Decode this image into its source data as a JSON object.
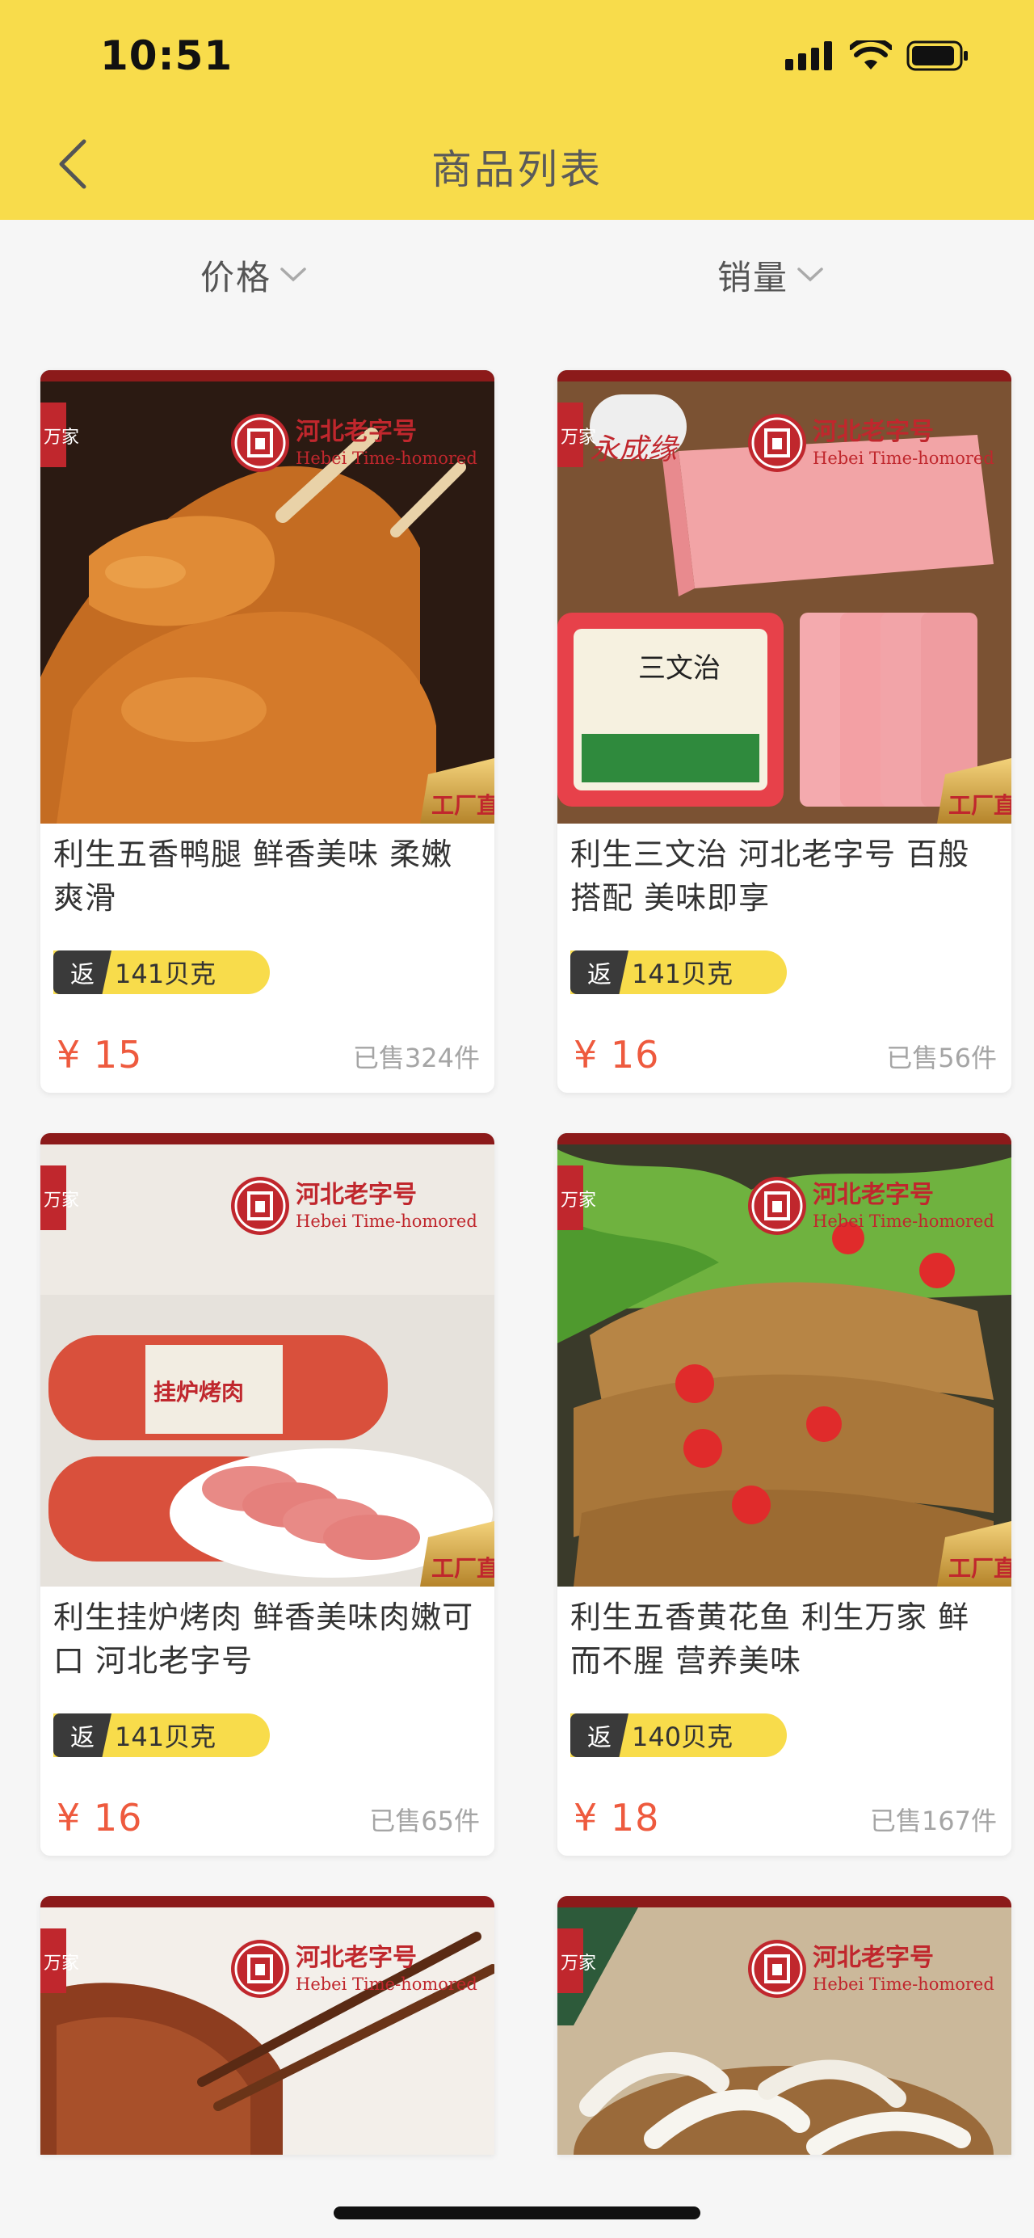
{
  "status_bar": {
    "time": "10:51"
  },
  "nav": {
    "title": "商品列表"
  },
  "sort": {
    "price_label": "价格",
    "sales_label": "销量"
  },
  "products": [
    {
      "title": "利生五香鸭腿 鲜香美味 柔嫩爽滑",
      "rebate_tag": "返",
      "rebate": "141贝克",
      "price": "¥ 15",
      "sold": "已售324件",
      "image": {
        "badge": "河北老字号",
        "badge_en": "Hebei Time-homored",
        "corner": "工厂直",
        "left_mark": "万家"
      }
    },
    {
      "title": "利生三文治 河北老字号 百般搭配 美味即享",
      "rebate_tag": "返",
      "rebate": "141贝克",
      "price": "¥ 16",
      "sold": "已售56件",
      "image": {
        "badge": "河北老字号",
        "badge_en": "Hebei Time-homored",
        "corner": "工厂直",
        "left_mark": "万家",
        "brand": "永成缘",
        "pack_label": "三文治"
      }
    },
    {
      "title": "利生挂炉烤肉 鲜香美味肉嫩可口 河北老字号",
      "rebate_tag": "返",
      "rebate": "141贝克",
      "price": "¥ 16",
      "sold": "已售65件",
      "image": {
        "badge": "河北老字号",
        "badge_en": "Hebei Time-homored",
        "corner": "工厂直",
        "left_mark": "万家",
        "pack_label": "挂炉烤肉"
      }
    },
    {
      "title": "利生五香黄花鱼 利生万家 鲜而不腥 营养美味",
      "rebate_tag": "返",
      "rebate": "140贝克",
      "price": "¥ 18",
      "sold": "已售167件",
      "image": {
        "badge": "河北老字号",
        "badge_en": "Hebei Time-homored",
        "corner": "工厂直",
        "left_mark": "万家"
      }
    },
    {
      "title": "",
      "rebate_tag": "",
      "rebate": "",
      "price": "",
      "sold": "",
      "image": {
        "badge": "河北老字号",
        "badge_en": "Hebei Time-homored",
        "corner": "",
        "left_mark": "万家"
      }
    },
    {
      "title": "",
      "rebate_tag": "",
      "rebate": "",
      "price": "",
      "sold": "",
      "image": {
        "badge": "河北老字号",
        "badge_en": "Hebei Time-homored",
        "corner": "",
        "left_mark": "万家"
      }
    }
  ],
  "colors": {
    "header": "#f8dc4b",
    "price": "#ee5a3e",
    "badge_red": "#c0272d"
  },
  "icons": {
    "back": "chevron-left-icon",
    "sort": "chevron-down-icon",
    "signal": "signal-icon",
    "wifi": "wifi-icon",
    "battery": "battery-icon"
  }
}
